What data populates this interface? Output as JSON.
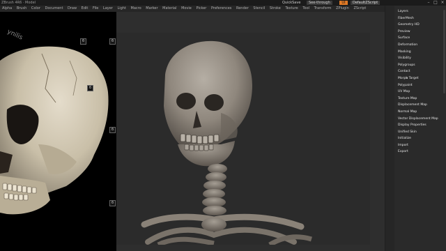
{
  "window": {
    "title": "ZBrush 4R6 · Model",
    "quicksave_label": "QuickSave",
    "seethrough_label": "See-through",
    "ui_label": "UI",
    "default_menu_label": "DefaultZScript"
  },
  "menubar": {
    "items": [
      "Alpha",
      "Brush",
      "Color",
      "Document",
      "Draw",
      "Edit",
      "File",
      "Layer",
      "Light",
      "Macro",
      "Marker",
      "Material",
      "Movie",
      "Picker",
      "Preferences",
      "Render",
      "Stencil",
      "Stroke",
      "Texture",
      "Tool",
      "Transform",
      "ZPlugin",
      "ZScript"
    ]
  },
  "reference_tray": {
    "marker_glyph": "б",
    "watermark": "ynilis"
  },
  "right_panel": {
    "items": [
      "Layers",
      "FiberMesh",
      "Geometry HD",
      "Preview",
      "Surface",
      "Deformation",
      "Masking",
      "Visibility",
      "Polygroups",
      "Contact",
      "Morph Target",
      "Polypaint",
      "UV Map",
      "Texture Map",
      "Displacement Map",
      "Normal Map",
      "Vector Displacement Map",
      "Display Properties",
      "Unified Skin",
      "Initialize",
      "Import",
      "Export"
    ]
  }
}
